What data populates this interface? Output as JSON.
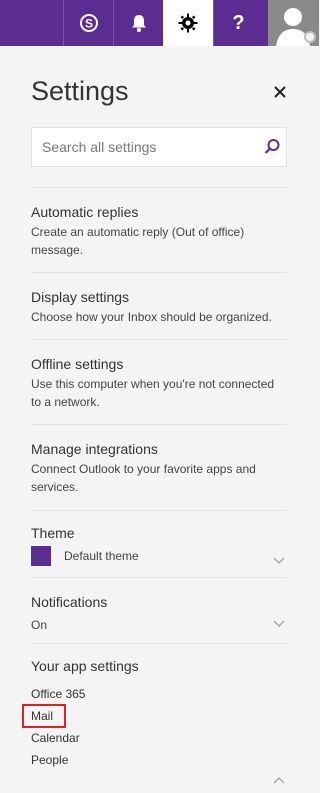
{
  "topbar": {
    "icons": [
      "skype-icon",
      "bell-icon",
      "gear-icon",
      "help-icon",
      "avatar"
    ],
    "help_glyph": "?",
    "accent_color": "#5c2d91"
  },
  "settings": {
    "title": "Settings",
    "search_placeholder": "Search all settings",
    "items": [
      {
        "title": "Automatic replies",
        "description": "Create an automatic reply (Out of office) message."
      },
      {
        "title": "Display settings",
        "description": "Choose how your Inbox should be organized."
      },
      {
        "title": "Offline settings",
        "description": "Use this computer when you're not connected to a network."
      },
      {
        "title": "Manage integrations",
        "description": "Connect Outlook to your favorite apps and services."
      }
    ],
    "theme": {
      "label": "Theme",
      "value": "Default theme"
    },
    "notifications": {
      "label": "Notifications",
      "value": "On"
    },
    "app_settings": {
      "label": "Your app settings",
      "links": [
        "Office 365",
        "Mail",
        "Calendar",
        "People"
      ]
    }
  }
}
